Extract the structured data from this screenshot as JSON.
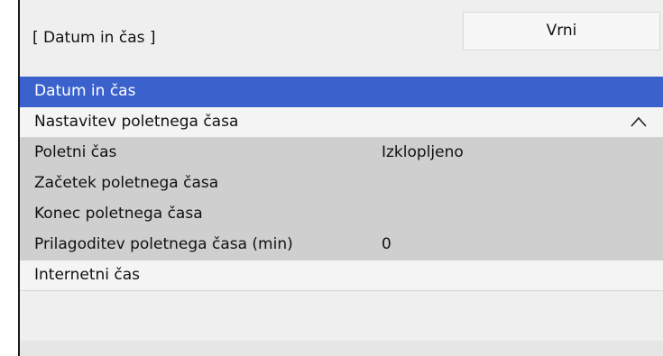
{
  "header": {
    "title": "[ Datum in čas ]",
    "back_label": "Vrni"
  },
  "menu": {
    "items": [
      {
        "label": "Datum in čas",
        "value": ""
      },
      {
        "label": "Nastavitev poletnega časa",
        "value": "",
        "icon": "chevron-up-icon"
      },
      {
        "label": "Poletni čas",
        "value": "Izklopljeno"
      },
      {
        "label": "Začetek poletnega časa",
        "value": ""
      },
      {
        "label": "Konec poletnega časa",
        "value": ""
      },
      {
        "label": "Prilagoditev poletnega časa (min)",
        "value": "0"
      },
      {
        "label": "Internetni čas",
        "value": ""
      }
    ]
  },
  "colors": {
    "selection": "#3b61cc",
    "submenu_background": "#cfcfcf",
    "panel_background": "#efefef"
  }
}
